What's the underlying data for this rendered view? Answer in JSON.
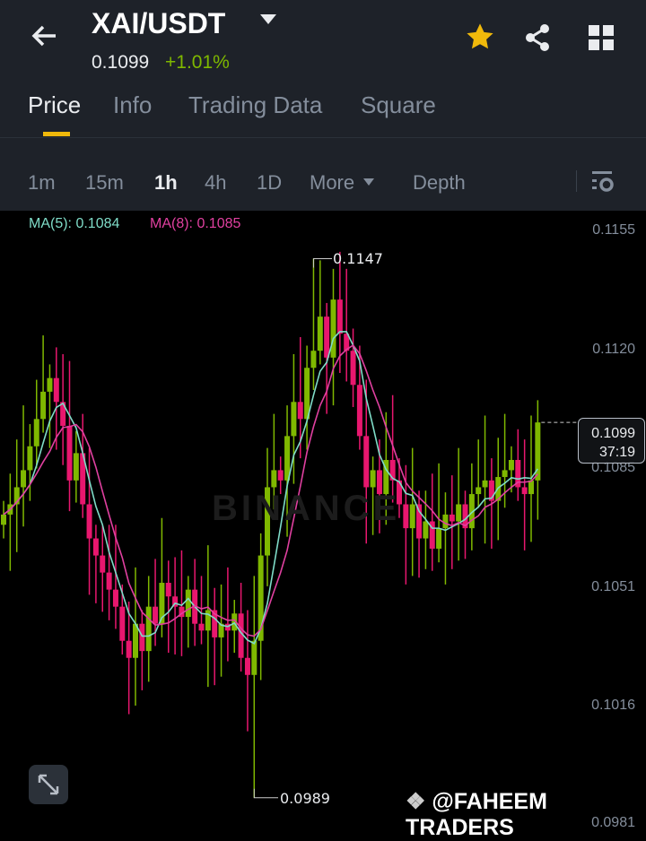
{
  "header": {
    "pair": "XAI/USDT",
    "last_price": "0.1099",
    "change": "+1.01%"
  },
  "tabs": [
    {
      "label": "Price",
      "active": true
    },
    {
      "label": "Info"
    },
    {
      "label": "Trading Data"
    },
    {
      "label": "Square"
    }
  ],
  "intervals": {
    "items": [
      "1m",
      "15m",
      "1h",
      "4h",
      "1D"
    ],
    "active": "1h",
    "more": "More",
    "depth": "Depth"
  },
  "indicators": {
    "ma5": "MA(5): 0.1084",
    "ma8": "MA(8): 0.1085"
  },
  "axis_labels": [
    "0.1155",
    "0.1120",
    "0.1085",
    "0.1051",
    "0.1016",
    "0.0981"
  ],
  "price_tag": {
    "price": "0.1099",
    "countdown": "37:19"
  },
  "markers": {
    "high": "0.1147",
    "low": "0.0989"
  },
  "watermark": "BINANCE",
  "branding": "@FAHEEM TRADERS",
  "colors": {
    "up": "#7fb800",
    "down": "#e8176e",
    "ma5": "#7fdcc8",
    "ma8": "#e040a0",
    "accent": "#f0b90b"
  },
  "chart_data": {
    "type": "candlestick",
    "interval": "1h",
    "closes": [
      0.1072,
      0.1075,
      0.108,
      0.1085,
      0.1092,
      0.11,
      0.1108,
      0.1112,
      0.1105,
      0.1098,
      0.1082,
      0.109,
      0.1075,
      0.1065,
      0.106,
      0.1055,
      0.105,
      0.1045,
      0.1035,
      0.103,
      0.104,
      0.1032,
      0.1045,
      0.104,
      0.1052,
      0.1048,
      0.1045,
      0.1042,
      0.105,
      0.104,
      0.1038,
      0.1044,
      0.1036,
      0.104,
      0.1038,
      0.1043,
      0.103,
      0.1025,
      0.1035,
      0.106,
      0.108,
      0.1085,
      0.1082,
      0.1095,
      0.1105,
      0.11,
      0.1115,
      0.112,
      0.113,
      0.1118,
      0.1135,
      0.1125,
      0.112,
      0.111,
      0.1095,
      0.108,
      0.1085,
      0.1078,
      0.1088,
      0.1082,
      0.1075,
      0.1068,
      0.1075,
      0.1065,
      0.107,
      0.1062,
      0.1068,
      0.1072,
      0.107,
      0.1075,
      0.1068,
      0.1078,
      0.108,
      0.1082,
      0.1076,
      0.1083,
      0.1085,
      0.1088,
      0.108,
      0.1078,
      0.1082,
      0.1099
    ],
    "high_index": 47,
    "high_value": 0.1147,
    "low_index": 38,
    "low_value": 0.0989,
    "ma_periods": [
      5,
      8
    ],
    "ylim": [
      0.0981,
      0.1155
    ]
  }
}
